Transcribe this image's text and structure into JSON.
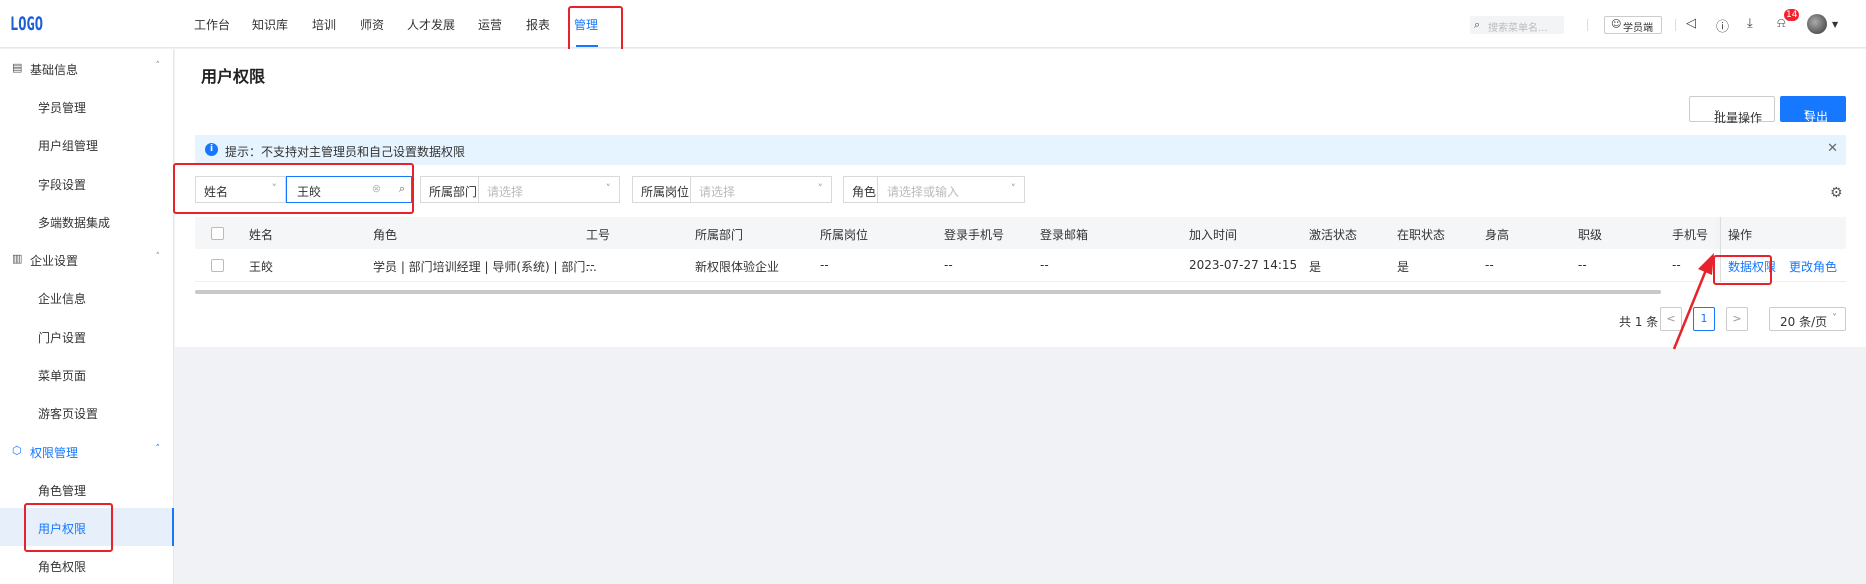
{
  "topnav": {
    "logo": "LOGO",
    "items": [
      "工作台",
      "知识库",
      "培训",
      "师资",
      "人才发展",
      "运营",
      "报表",
      "管理"
    ],
    "active": "管理",
    "search_placeholder": "搜索菜单名...",
    "student_btn": "学员端",
    "notification_count": "14"
  },
  "sidebar": {
    "groups": [
      {
        "label": "基础信息",
        "items": [
          "学员管理",
          "用户组管理",
          "字段设置",
          "多端数据集成"
        ]
      },
      {
        "label": "企业设置",
        "items": [
          "企业信息",
          "门户设置",
          "菜单页面",
          "游客页设置"
        ]
      },
      {
        "label": "权限管理",
        "items": [
          "角色管理",
          "用户权限",
          "角色权限"
        ]
      }
    ],
    "active_item": "用户权限"
  },
  "main": {
    "title": "用户权限",
    "batch_btn": "批量操作",
    "export_btn": "导出",
    "alert": "提示：不支持对主管理员和自己设置数据权限",
    "filters": {
      "field_select": "姓名",
      "field_value": "王皎",
      "dept_label": "所属部门",
      "dept_placeholder": "请选择",
      "post_label": "所属岗位",
      "post_placeholder": "请选择",
      "role_label": "角色",
      "role_placeholder": "请选择或输入"
    },
    "table": {
      "headers": [
        "姓名",
        "角色",
        "工号",
        "所属部门",
        "所属岗位",
        "登录手机号",
        "登录邮箱",
        "加入时间",
        "激活状态",
        "在职状态",
        "身高",
        "职级",
        "手机号",
        "操作"
      ],
      "rows": [
        {
          "name": "王皎",
          "role": "学员 | 部门培训经理 | 导师(系统) | 部门...",
          "job_no": "--",
          "dept": "新权限体验企业",
          "post": "--",
          "login_phone": "--",
          "login_email": "--",
          "join_time": "2023-07-27 14:15",
          "active": "是",
          "employed": "是",
          "height": "--",
          "level": "--",
          "phone": "--",
          "action_data": "数据权限",
          "action_role": "更改角色"
        }
      ]
    },
    "pagination": {
      "total": "共 1 条",
      "current": "1",
      "page_size": "20 条/页"
    }
  },
  "colors": {
    "accent": "#1677ff",
    "highlight_box": "#e6232a"
  }
}
